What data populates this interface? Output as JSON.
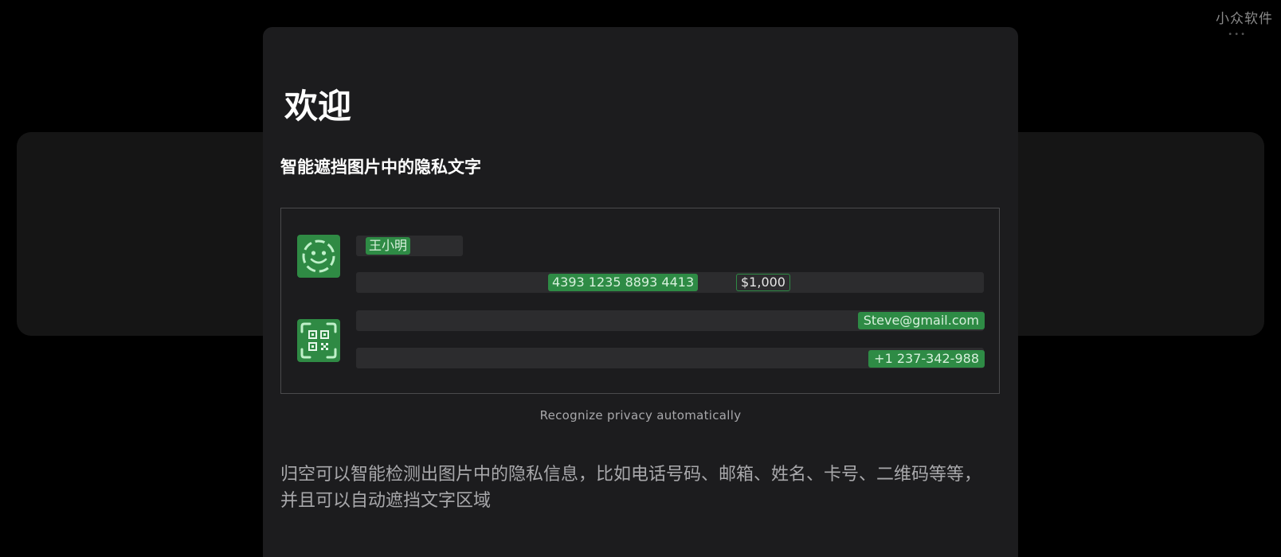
{
  "watermark": {
    "label": "小众软件"
  },
  "welcome": {
    "title": "欢迎",
    "subtitle": "智能遮挡图片中的隐私文字",
    "demo": {
      "face_icon": "face-detection-icon",
      "qr_icon": "qr-code-scan-icon",
      "name_tag": "王小明",
      "card_number_tag": "4393 1235 8893 4413",
      "amount_tag": "$1,000",
      "email_tag": "Steve@gmail.com",
      "phone_tag": "+1 237-342-988"
    },
    "caption": "Recognize privacy automatically",
    "description": "归空可以智能检测出图片中的隐私信息，比如电话号码、邮箱、姓名、卡号、二维码等等，并且可以自动遮挡文字区域"
  },
  "colors": {
    "background": "#000000",
    "sheet": "#1c1c1e",
    "accent_green": "#2e8b45",
    "placeholder_bar": "#2c2c2e",
    "secondary_text": "#a8a8ab"
  }
}
